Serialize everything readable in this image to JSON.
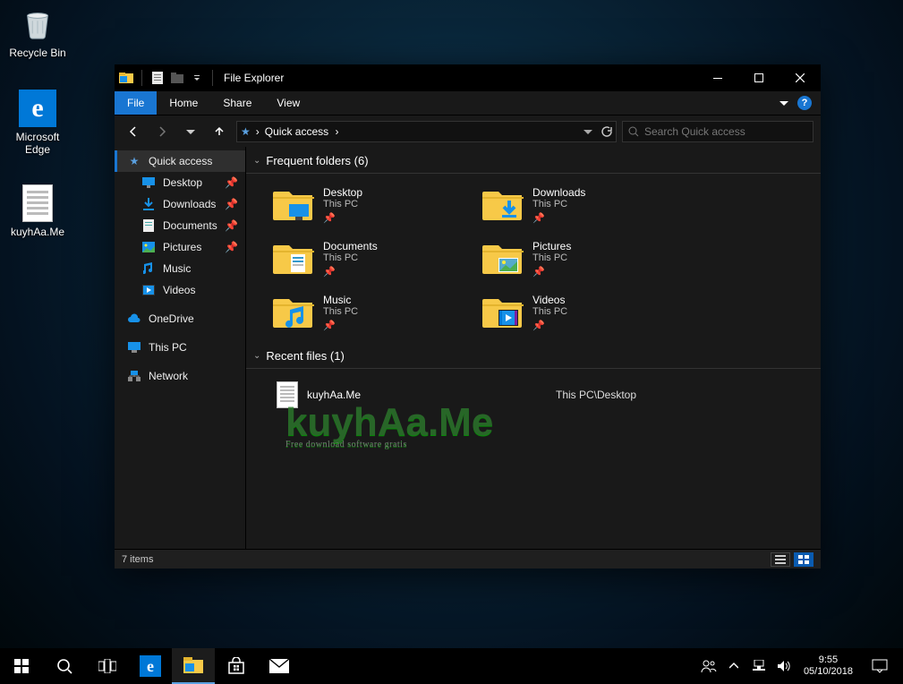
{
  "desktop": {
    "icons": [
      {
        "label": "Recycle Bin"
      },
      {
        "label": "Microsoft Edge"
      },
      {
        "label": "kuyhAa.Me"
      }
    ]
  },
  "window": {
    "title": "File Explorer",
    "ribbon": {
      "file": "File",
      "tabs": [
        "Home",
        "Share",
        "View"
      ]
    },
    "breadcrumb": {
      "root": "Quick access",
      "sep": "›"
    },
    "search": {
      "placeholder": "Search Quick access"
    },
    "navpane": {
      "quick_access": "Quick access",
      "children": [
        {
          "label": "Desktop",
          "icon": "desktop"
        },
        {
          "label": "Downloads",
          "icon": "downloads"
        },
        {
          "label": "Documents",
          "icon": "documents"
        },
        {
          "label": "Pictures",
          "icon": "pictures"
        },
        {
          "label": "Music",
          "icon": "music"
        },
        {
          "label": "Videos",
          "icon": "videos"
        }
      ],
      "onedrive": "OneDrive",
      "thispc": "This PC",
      "network": "Network"
    },
    "groups": {
      "frequent": {
        "title": "Frequent folders (6)"
      },
      "recent": {
        "title": "Recent files (1)"
      }
    },
    "folders": [
      {
        "name": "Desktop",
        "sub": "This PC",
        "icon": "desktop"
      },
      {
        "name": "Downloads",
        "sub": "This PC",
        "icon": "downloads"
      },
      {
        "name": "Documents",
        "sub": "This PC",
        "icon": "documents"
      },
      {
        "name": "Pictures",
        "sub": "This PC",
        "icon": "pictures"
      },
      {
        "name": "Music",
        "sub": "This PC",
        "icon": "music"
      },
      {
        "name": "Videos",
        "sub": "This PC",
        "icon": "videos"
      }
    ],
    "recent_files": [
      {
        "name": "kuyhAa.Me",
        "path": "This PC\\Desktop"
      }
    ],
    "status": {
      "text": "7 items"
    }
  },
  "watermark": {
    "text": "kuyhAa.Me",
    "sub": "Free download software gratis"
  },
  "taskbar": {
    "clock": {
      "time": "9:55",
      "date": "05/10/2018"
    }
  }
}
